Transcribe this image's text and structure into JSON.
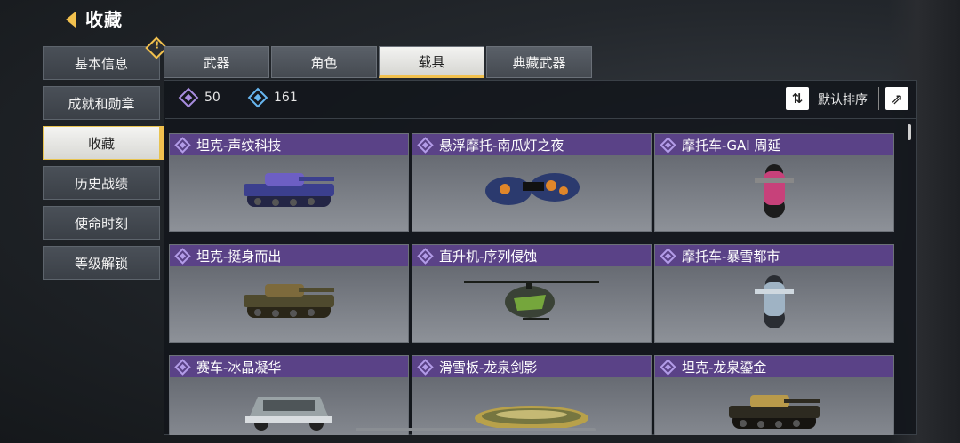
{
  "header": {
    "title": "收藏"
  },
  "sidebar": {
    "items": [
      {
        "label": "基本信息",
        "badge": "!"
      },
      {
        "label": "成就和勋章"
      },
      {
        "label": "收藏"
      },
      {
        "label": "历史战绩"
      },
      {
        "label": "使命时刻"
      },
      {
        "label": "等级解锁"
      }
    ]
  },
  "tabs": [
    {
      "label": "武器"
    },
    {
      "label": "角色"
    },
    {
      "label": "载具"
    },
    {
      "label": "典藏武器"
    }
  ],
  "stats": {
    "epic_count": "50",
    "rare_count": "161"
  },
  "toolbar": {
    "sort_icon": "⇅",
    "sort_label": "默认排序",
    "share_icon": "⇗"
  },
  "colors": {
    "accent": "#f2c14e",
    "card_header": "#5a4287",
    "epic": "#a88de0",
    "rare": "#67b6f0"
  },
  "cards": [
    {
      "name": "坦克-声纹科技",
      "art": "tank",
      "palette": [
        "#3b3f8e",
        "#6d5fc4",
        "#232545"
      ]
    },
    {
      "name": "悬浮摩托-南瓜灯之夜",
      "art": "hoverbike",
      "palette": [
        "#e0862a",
        "#2b3a6e",
        "#111"
      ]
    },
    {
      "name": "摩托车-GAI 周延",
      "art": "moto",
      "palette": [
        "#c7417a",
        "#1c1c1c",
        "#888"
      ]
    },
    {
      "name": "坦克-挺身而出",
      "art": "tank",
      "palette": [
        "#4f4a2e",
        "#7d6a3c",
        "#2a2618"
      ]
    },
    {
      "name": "直升机-序列侵蚀",
      "art": "heli",
      "palette": [
        "#3a4236",
        "#8fd13f",
        "#1a1d18"
      ]
    },
    {
      "name": "摩托车-暴雪都市",
      "art": "moto",
      "palette": [
        "#9fb3c4",
        "#2a2d33",
        "#cfd8df"
      ]
    },
    {
      "name": "赛车-冰晶凝华",
      "art": "car",
      "palette": [
        "#9aa3a6",
        "#4e5558",
        "#d9dde0"
      ]
    },
    {
      "name": "滑雪板-龙泉剑影",
      "art": "board",
      "palette": [
        "#b8a14a",
        "#4a5a3a",
        "#e7d58a"
      ]
    },
    {
      "name": "坦克-龙泉鎏金",
      "art": "tank",
      "palette": [
        "#2d2a20",
        "#b99a4a",
        "#161410"
      ]
    }
  ]
}
